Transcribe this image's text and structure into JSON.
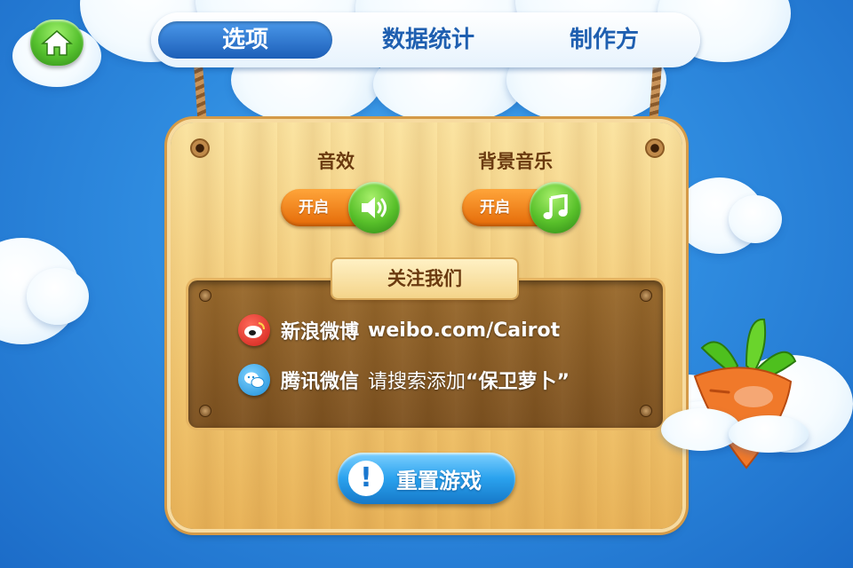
{
  "tabs": [
    {
      "label": "选项",
      "active": true
    },
    {
      "label": "数据统计",
      "active": false
    },
    {
      "label": "制作方",
      "active": false
    }
  ],
  "home": {
    "icon": "home-icon"
  },
  "sound": {
    "label": "音效",
    "toggle_text": "开启",
    "icon": "speaker-icon"
  },
  "music": {
    "label": "背景音乐",
    "toggle_text": "开启",
    "icon": "music-note-icon"
  },
  "follow": {
    "title": "关注我们",
    "weibo": {
      "name": "新浪微博",
      "value": "weibo.com/Cairot",
      "icon": "weibo-icon"
    },
    "wechat": {
      "name": "腾讯微信",
      "prefix": "请搜索添加",
      "value": "“保卫萝卜”",
      "icon": "wechat-icon"
    }
  },
  "reset": {
    "label": "重置游戏",
    "icon": "exclamation-icon"
  },
  "colors": {
    "sky": "#2f8ce0",
    "tab_active": "#1d5fb8",
    "toggle": "#e46a08",
    "knob": "#58c02a",
    "board": "#f2c873",
    "panel": "#7e5220",
    "reset_button": "#2aa2ee",
    "carrot": "#f0792a"
  }
}
